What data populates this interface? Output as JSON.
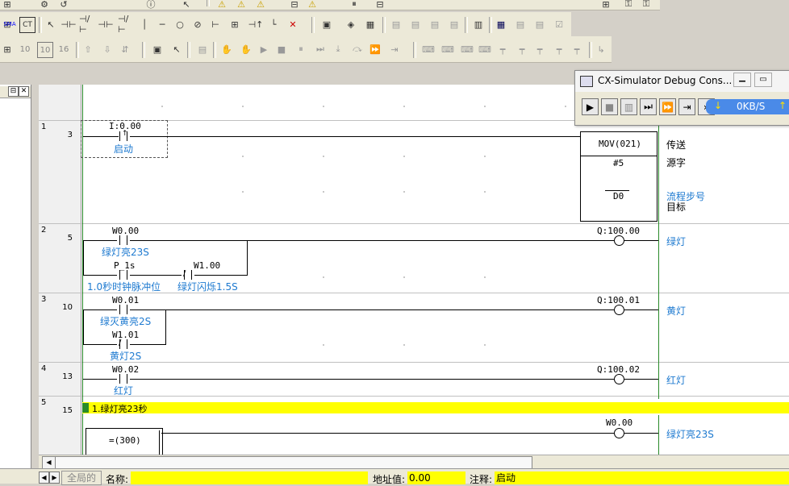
{
  "toolbar1": {
    "icons": [
      "ladder-icon",
      "wrench-icon",
      "printer-icon",
      "info-icon",
      "arrow-icon",
      "cursor-help-icon",
      "warning-icon",
      "network-icon",
      "key-icon"
    ]
  },
  "toolbar2": {
    "sma_label": "SMA",
    "ct_label": "CT"
  },
  "toolbar3": {
    "num1": "10",
    "num2": "10",
    "num3": "16"
  },
  "rungs": [
    {
      "index": "1",
      "step": "3"
    },
    {
      "index": "2",
      "step": "5"
    },
    {
      "index": "3",
      "step": "10"
    },
    {
      "index": "4",
      "step": "13"
    },
    {
      "index": "5",
      "step": "15"
    }
  ],
  "rung1": {
    "contact_addr": "I:0.00",
    "contact_comment": "启动",
    "instr": "MOV(021)",
    "operand1": "#5",
    "operand2": "D0",
    "label_op": "传送",
    "label_src": "源字",
    "label_dst_comment": "流程步号",
    "label_dst": "目标"
  },
  "rung2": {
    "c1_addr": "W0.00",
    "c1_comment": "绿灯亮23S",
    "c2_addr": "P_1s",
    "c2_comment": "1.0秒时钟脉冲位",
    "c3_addr": "W1.00",
    "c3_comment": "绿灯闪烁1.5S",
    "coil_addr": "Q:100.00",
    "coil_comment": "绿灯"
  },
  "rung3": {
    "c1_addr": "W0.01",
    "c1_comment": "绿灭黄亮2S",
    "c2_addr": "W1.01",
    "c2_comment": "黄灯2S",
    "coil_addr": "Q:100.01",
    "coil_comment": "黄灯"
  },
  "rung4": {
    "c1_addr": "W0.02",
    "c1_comment": "红灯",
    "coil_addr": "Q:100.02",
    "coil_comment": "红灯"
  },
  "rung5": {
    "banner": "1.绿灯亮23秒",
    "compare": "=(300)",
    "coil_addr": "W0.00",
    "coil_comment": "绿灯亮23S"
  },
  "debug": {
    "title": "CX-Simulator Debug Cons...",
    "speed": "0KB/S",
    "controls": [
      "run",
      "stop",
      "pause",
      "step",
      "step-run",
      "step-out",
      "continuous"
    ]
  },
  "status": {
    "tab_label": "全局的",
    "name_label": "名称:",
    "name_value": "",
    "address_label": "地址值:",
    "address_value": "0.00",
    "comment_label": "注释:",
    "comment_value": "启动"
  },
  "colors": {
    "comment": "#1e7ad0",
    "rail": "#2a8a2a",
    "highlight": "#ffff00"
  }
}
